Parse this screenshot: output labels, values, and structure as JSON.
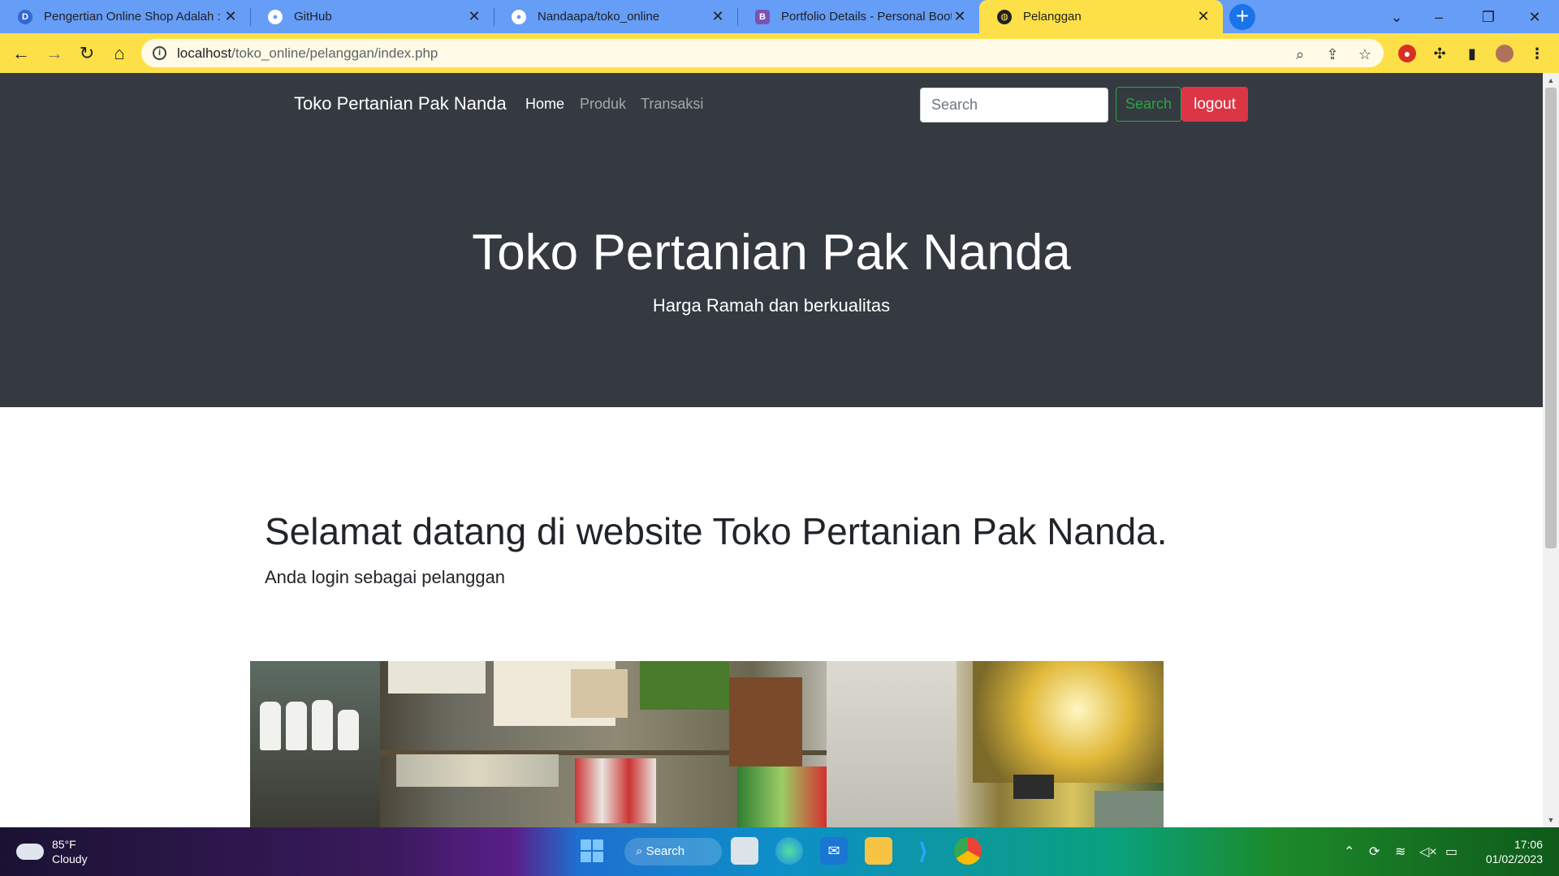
{
  "browser": {
    "tabs": [
      {
        "title": "Pengertian Online Shop Adalah :",
        "icon": "dicoding-icon",
        "icon_letter": "D"
      },
      {
        "title": "GitHub",
        "icon": "github-icon"
      },
      {
        "title": "Nandaapa/toko_online",
        "icon": "github-icon"
      },
      {
        "title": "Portfolio Details - Personal Boots",
        "icon": "bootstrap-icon",
        "icon_letter": "B"
      },
      {
        "title": "Pelanggan",
        "icon": "globe-icon"
      }
    ],
    "url_host": "localhost",
    "url_path": "/toko_online/pelanggan/index.php"
  },
  "navbar": {
    "brand": "Toko Pertanian Pak Nanda",
    "links": [
      "Home",
      "Produk",
      "Transaksi"
    ],
    "search_placeholder": "Search",
    "search_button": "Search",
    "logout_button": "logout"
  },
  "hero": {
    "title": "Toko Pertanian Pak Nanda",
    "subtitle": "Harga Ramah dan berkualitas"
  },
  "content": {
    "welcome": "Selamat datang di website Toko Pertanian Pak Nanda.",
    "role_text": "Anda login sebagai pelanggan"
  },
  "taskbar": {
    "weather_temp": "85°F",
    "weather_desc": "Cloudy",
    "search_label": "Search",
    "time": "17:06",
    "date": "01/02/2023"
  },
  "colors": {
    "tab_strip": "#669df6",
    "active_tab": "#fde047",
    "navbar_bg": "#343a40",
    "logout": "#dc3545",
    "search_outline": "#28a745"
  }
}
